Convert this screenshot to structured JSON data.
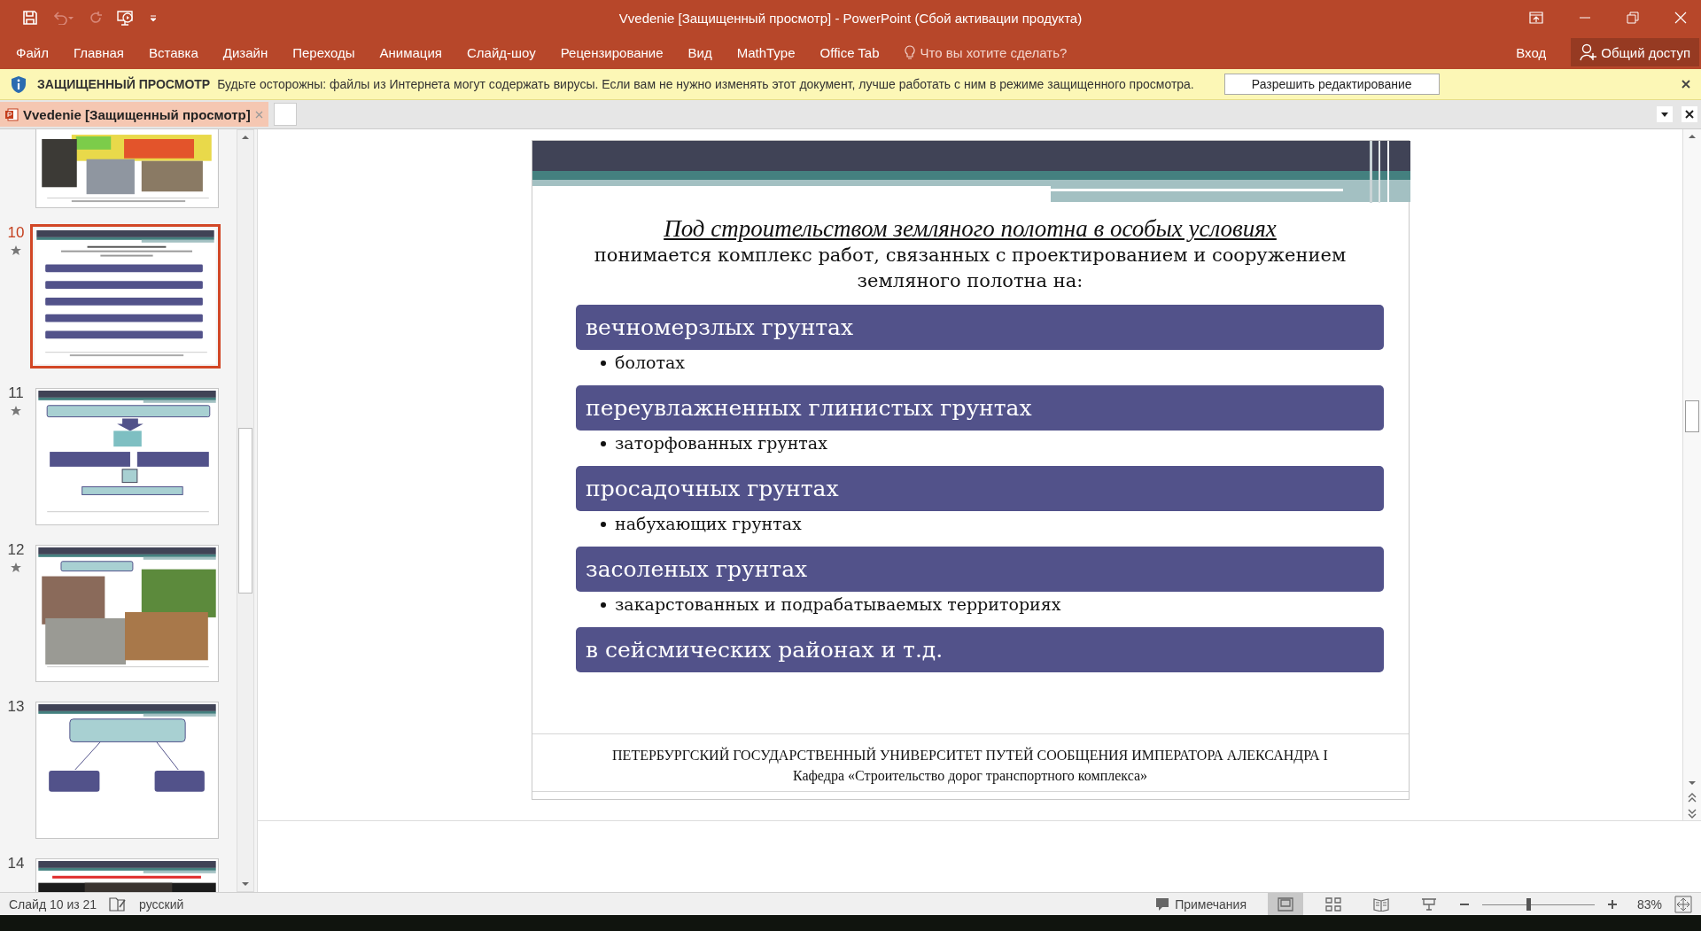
{
  "window": {
    "title": "Vvedenie [Защищенный просмотр] - PowerPoint (Сбой активации продукта)"
  },
  "ribbon_tabs": [
    {
      "label": "Файл"
    },
    {
      "label": "Главная"
    },
    {
      "label": "Вставка"
    },
    {
      "label": "Дизайн"
    },
    {
      "label": "Переходы"
    },
    {
      "label": "Анимация"
    },
    {
      "label": "Слайд-шоу"
    },
    {
      "label": "Рецензирование"
    },
    {
      "label": "Вид"
    },
    {
      "label": "MathType"
    },
    {
      "label": "Office Tab"
    }
  ],
  "tell_me": "Что вы хотите сделать?",
  "sign_in": "Вход",
  "share": "Общий доступ",
  "protected_bar": {
    "title": "ЗАЩИЩЕННЫЙ ПРОСМОТР",
    "message": "Будьте осторожны: файлы из Интернета могут содержать вирусы. Если вам не нужно изменять этот документ, лучше работать с ним в режиме защищенного просмотра.",
    "button": "Разрешить редактирование"
  },
  "document_tabs": [
    {
      "label": "Vvedenie [Защищенный просмотр]",
      "selected": true
    }
  ],
  "thumbnails": [
    {
      "kind": "photos",
      "selected": false,
      "starred": false
    },
    {
      "number": "10",
      "kind": "list",
      "selected": true,
      "starred": true
    },
    {
      "number": "11",
      "kind": "diagram",
      "selected": false,
      "starred": true
    },
    {
      "number": "12",
      "kind": "examples",
      "selected": false,
      "starred": true
    },
    {
      "number": "13",
      "kind": "tree",
      "selected": false,
      "starred": false
    },
    {
      "number": "14",
      "kind": "title",
      "selected": false,
      "starred": false
    }
  ],
  "slide": {
    "heading": "Под строительством земляного полотна в особых условиях",
    "intro": "понимается комплекс работ, связанных с проектированием и сооружением земляного полотна на:",
    "items": [
      {
        "label": "вечномерзлых грунтах",
        "sub": "болотах"
      },
      {
        "label": "переувлажненных глинистых грунтах",
        "sub": "заторфованных грунтах"
      },
      {
        "label": "просадочных грунтах",
        "sub": "набухающих  грунтах"
      },
      {
        "label": "засоленых грунтах",
        "sub": "закарстованных и подрабатываемых территориях"
      },
      {
        "label": "в сейсмических районах и т.д."
      }
    ],
    "footer": [
      "ПЕТЕРБУРГСКИЙ ГОСУДАРСТВЕННЫЙ УНИВЕРСИТЕТ ПУТЕЙ СООБЩЕНИЯ ИМПЕРАТОРА АЛЕКСАНДРА I",
      "Кафедра «Строительство дорог транспортного комплекса»"
    ]
  },
  "status_bar": {
    "slide": "Слайд 10 из 21",
    "language": "русский",
    "notes": "Примечания",
    "views": [
      {
        "kind": "normal",
        "selected": true
      },
      {
        "kind": "sorter",
        "selected": false
      },
      {
        "kind": "reading",
        "selected": false
      },
      {
        "kind": "show",
        "selected": false
      }
    ],
    "zoom": {
      "level": 0.41,
      "value": "83%"
    }
  }
}
